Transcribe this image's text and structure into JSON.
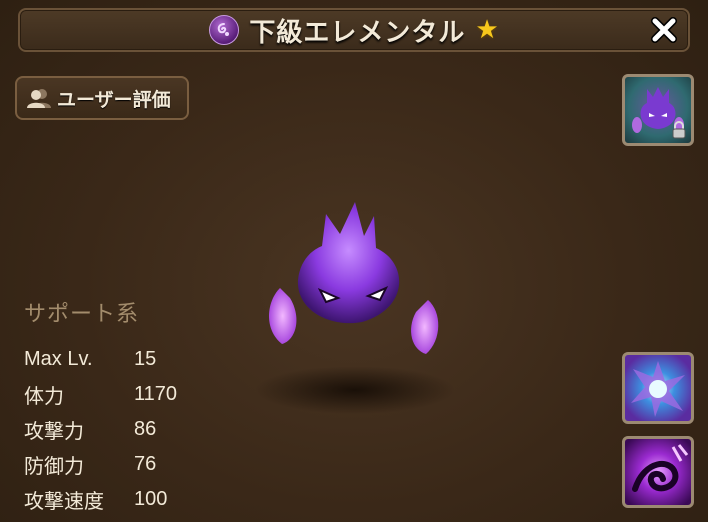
{
  "header": {
    "title": "下級エレメンタル",
    "element_icon": "dark-element-icon",
    "star_icon": "star-icon",
    "close_icon": "close-icon"
  },
  "review_button": {
    "label": "ユーザー評価",
    "icon": "users-icon"
  },
  "portrait": {
    "icon": "monster-portrait-icon",
    "locked": true
  },
  "skills": [
    {
      "name": "skill-1-icon"
    },
    {
      "name": "skill-2-icon"
    }
  ],
  "stats": {
    "type_label": "サポート系",
    "rows": [
      {
        "name": "Max Lv.",
        "value": "15"
      },
      {
        "name": "体力",
        "value": "1170"
      },
      {
        "name": "攻撃力",
        "value": "86"
      },
      {
        "name": "防御力",
        "value": "76"
      },
      {
        "name": "攻撃速度",
        "value": "100"
      }
    ]
  },
  "colors": {
    "background": "#3a2818",
    "text": "#f3ead8",
    "type_label": "#a38c6c",
    "star": "#f7c81c",
    "monster": "#8a3ae0"
  }
}
